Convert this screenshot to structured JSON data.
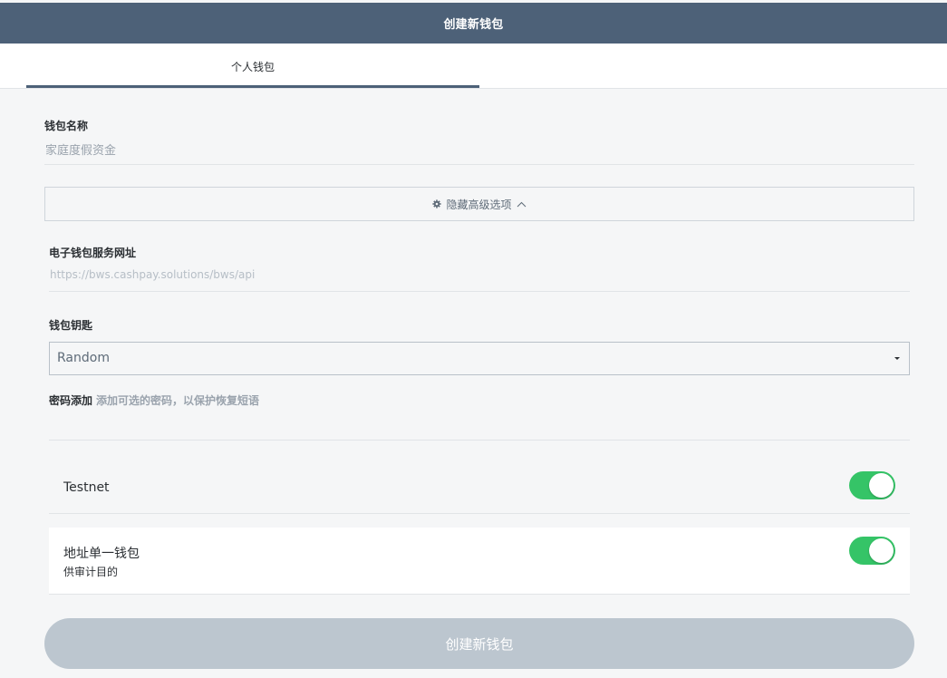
{
  "header": {
    "title": "创建新钱包"
  },
  "tabs": [
    {
      "label": "个人钱包",
      "active": true
    }
  ],
  "wallet_name": {
    "label": "钱包名称",
    "placeholder": "家庭度假资金"
  },
  "advanced": {
    "toggle_label": "隐藏高级选项"
  },
  "wallet_service": {
    "label": "电子钱包服务网址",
    "value": "https://bws.cashpay.solutions/bws/api"
  },
  "wallet_key": {
    "label": "钱包钥匙",
    "selected": "Random"
  },
  "password": {
    "label": "密码添加",
    "description": "添加可选的密码，以保护恢复短语"
  },
  "testnet": {
    "label": "Testnet",
    "enabled": true
  },
  "single_address": {
    "label": "地址单一钱包",
    "sublabel": "供审计目的",
    "enabled": true
  },
  "actions": {
    "create_label": "创建新钱包"
  },
  "colors": {
    "header_bg": "#4d6178",
    "toggle_on": "#35c467",
    "button_disabled": "#bcc6cf",
    "page_bg": "#f5f6f7"
  }
}
